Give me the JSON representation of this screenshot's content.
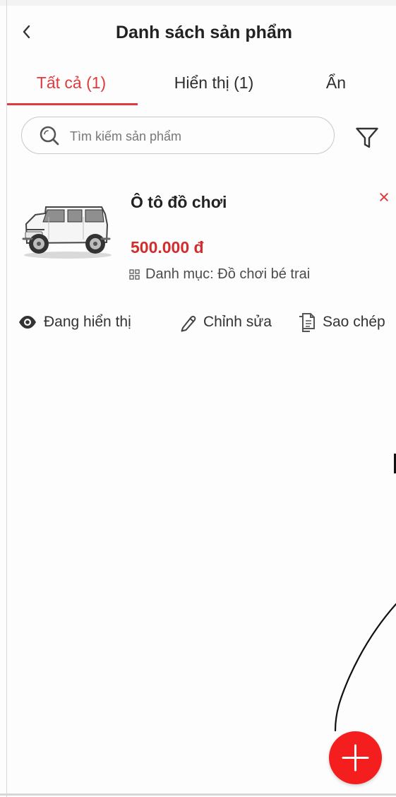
{
  "header": {
    "back_icon": "back-arrow-icon",
    "title": "Danh sách sản phẩm"
  },
  "tabs": [
    {
      "label": "Tất cả (1)",
      "active": true
    },
    {
      "label": "Hiển thị (1)",
      "active": false
    },
    {
      "label": "Ẩn",
      "active": false
    }
  ],
  "search": {
    "placeholder": "Tìm kiếm sản phẩm",
    "icon": "search-icon"
  },
  "filter": {
    "icon": "filter-icon"
  },
  "product": {
    "name": "Ô tô đồ chơi",
    "price": "500.000 đ",
    "category": "Danh mục: Đồ chơi bé trai",
    "image": "white-toy-suv-image",
    "remove_icon": "close-icon"
  },
  "actions": [
    {
      "label": "Đang hiển thị",
      "icon": "eye-icon"
    },
    {
      "label": "Chỉnh sửa",
      "icon": "pencil-icon"
    },
    {
      "label": "Sao chép",
      "icon": "copy-icon"
    }
  ],
  "fab": {
    "icon": "plus-icon"
  },
  "colors": {
    "accent": "#df3b3b",
    "price": "#d22d2d",
    "fab": "#f41e1e"
  }
}
